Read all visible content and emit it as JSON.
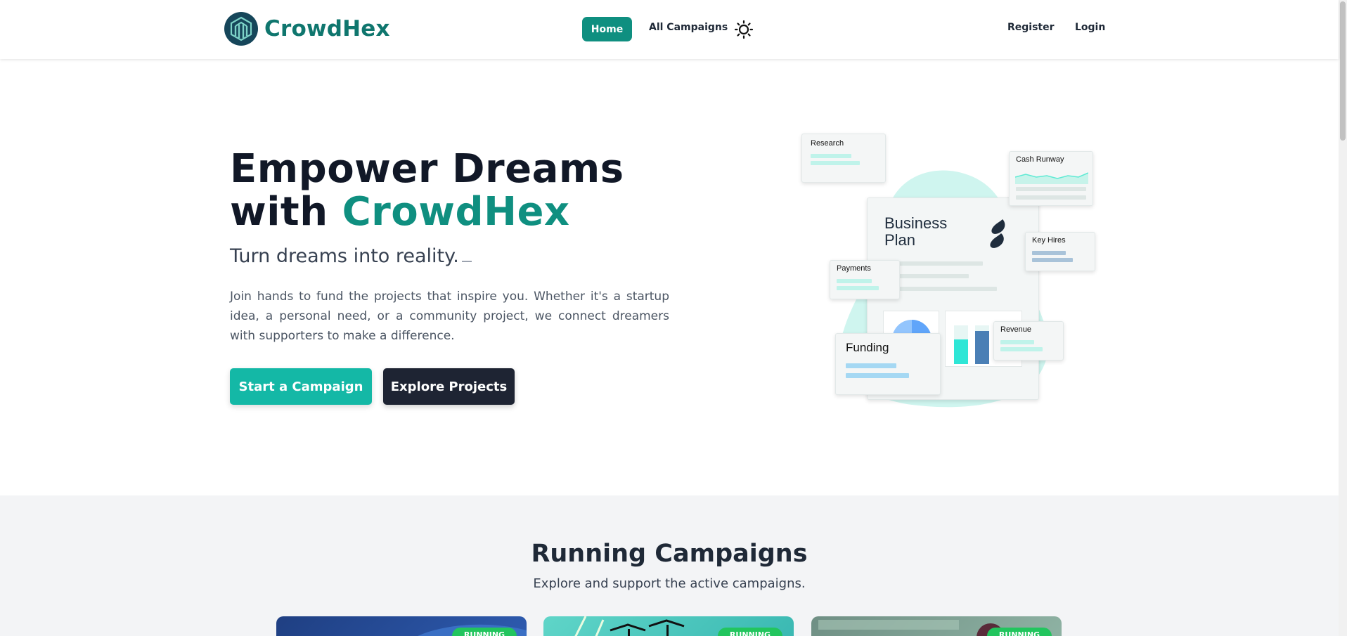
{
  "brand": {
    "name": "CrowdHex"
  },
  "nav": {
    "home": "Home",
    "campaigns": "All Campaigns",
    "theme_icon": "sun-icon",
    "register": "Register",
    "login": "Login"
  },
  "hero": {
    "title_line1": "Empower Dreams",
    "title_prefix": "with ",
    "title_accent": "CrowdHex",
    "subtitle": "Turn dreams into reality.",
    "description": "Join hands to fund the projects that inspire you. Whether it's a startup idea, a personal need, or a community project, we connect dreamers with supporters to make a difference.",
    "primary_button": "Start a Campaign",
    "secondary_button": "Explore Projects"
  },
  "illustration": {
    "research": "Research",
    "cash_runway": "Cash Runway",
    "business_plan_line1": "Business",
    "business_plan_line2": "Plan",
    "key_hires": "Key Hires",
    "payments": "Payments",
    "revenue": "Revenue",
    "funding": "Funding"
  },
  "campaigns": {
    "title": "Running Campaigns",
    "subtitle": "Explore and support the active campaigns.",
    "cards": [
      {
        "status": "RUNNING"
      },
      {
        "status": "RUNNING"
      },
      {
        "status": "RUNNING"
      }
    ]
  },
  "colors": {
    "accent": "#0f8f80",
    "primary_button": "#14b8a6",
    "dark_button": "#1e2433",
    "running_badge": "#22c55e"
  }
}
